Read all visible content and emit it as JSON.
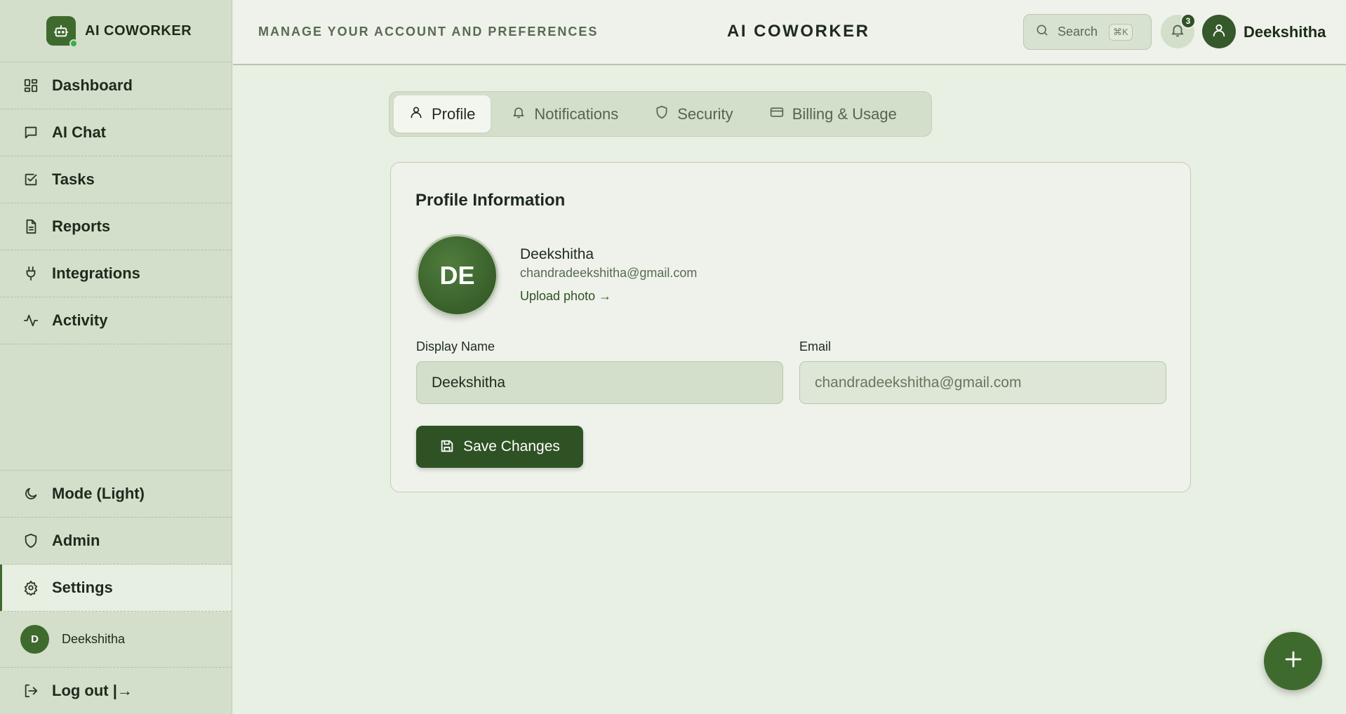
{
  "brand": {
    "name": "AI COWORKER"
  },
  "sidebar": {
    "items": [
      {
        "label": "Dashboard",
        "icon": "dashboard-icon"
      },
      {
        "label": "AI Chat",
        "icon": "chat-icon"
      },
      {
        "label": "Tasks",
        "icon": "checkbox-icon"
      },
      {
        "label": "Reports",
        "icon": "document-icon"
      },
      {
        "label": "Integrations",
        "icon": "plug-icon"
      },
      {
        "label": "Activity",
        "icon": "activity-icon"
      }
    ],
    "bottom": [
      {
        "label": "Mode (Light)",
        "icon": "moon-icon"
      },
      {
        "label": "Admin",
        "icon": "shield-icon"
      },
      {
        "label": "Settings",
        "icon": "gear-icon",
        "active": true
      }
    ],
    "user": {
      "initial": "D",
      "name": "Deekshitha"
    },
    "logout_label": "Log out |→"
  },
  "header": {
    "subtitle": "MANAGE YOUR ACCOUNT AND PREFERENCES",
    "title": "AI COWORKER",
    "search_label": "Search",
    "search_shortcut": "⌘K",
    "notification_count": "3",
    "user_name": "Deekshitha"
  },
  "tabs": [
    {
      "label": "Profile",
      "icon": "user-icon",
      "active": true
    },
    {
      "label": "Notifications",
      "icon": "bell-icon"
    },
    {
      "label": "Security",
      "icon": "shield-icon"
    },
    {
      "label": "Billing & Usage",
      "icon": "credit-card-icon"
    }
  ],
  "profile": {
    "card_title": "Profile Information",
    "initials": "DE",
    "name": "Deekshitha",
    "email": "chandradeekshitha@gmail.com",
    "upload_label": "Upload photo →",
    "display_name_label": "Display Name",
    "display_name_value": "Deekshitha",
    "email_label": "Email",
    "email_value": "chandradeekshitha@gmail.com",
    "save_label": "Save Changes"
  },
  "colors": {
    "accent": "#3f6a2e",
    "accent_dark": "#2f5224",
    "sidebar_bg": "#d3decb",
    "page_bg": "#e8efe3"
  }
}
